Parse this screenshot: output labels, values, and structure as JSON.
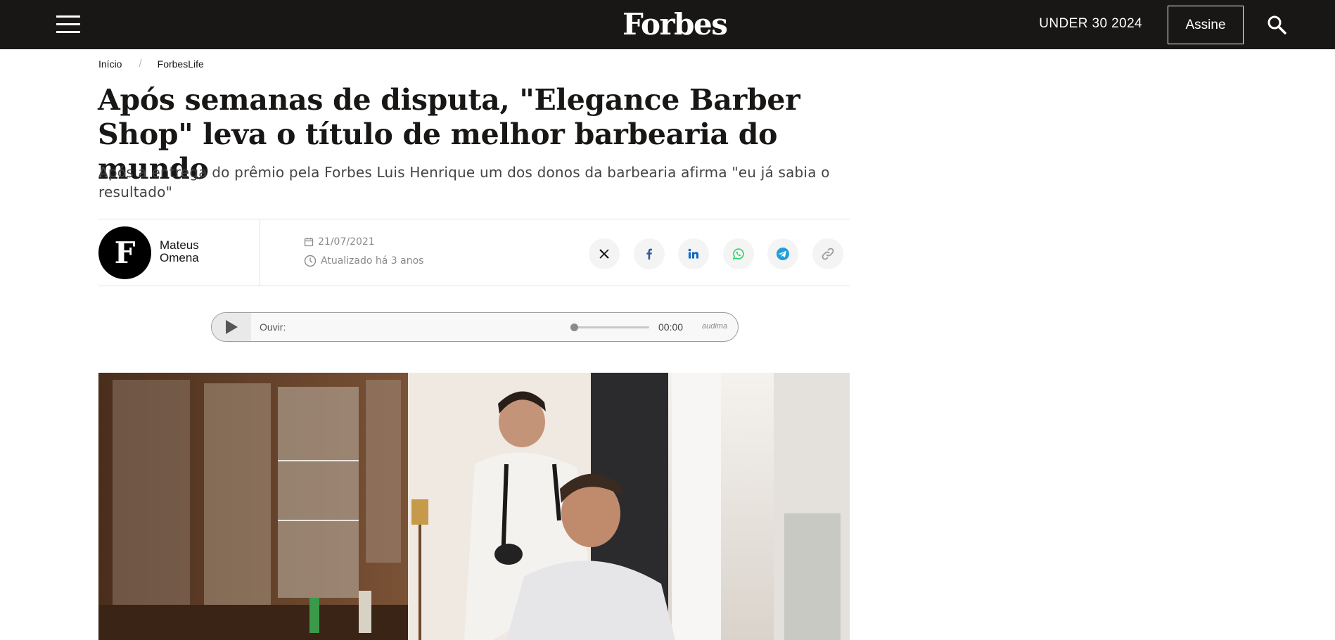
{
  "header": {
    "logo": "Forbes",
    "under30_label": "UNDER 30 2024",
    "subscribe_label": "Assine",
    "menu_icon": "hamburger-menu-icon",
    "search_icon": "search-icon",
    "background_color": "#181716"
  },
  "breadcrumb": {
    "items": [
      "Início",
      "ForbesLife"
    ],
    "separator": "/"
  },
  "article": {
    "title": "Após semanas de disputa, \"Elegance Barber Shop\" leva o título de melhor barbearia do mundo",
    "subtitle": "Após a entrega do prêmio pela Forbes Luis Henrique um dos donos da barbearia afirma \"eu já sabia o resultado\"",
    "author": {
      "initial": "F",
      "name": "Mateus Omena"
    },
    "published_date": "21/07/2021",
    "updated_text": "Atualizado há 3 anos"
  },
  "share": {
    "buttons": [
      {
        "name": "x",
        "icon": "x-twitter-icon",
        "color": "#181716"
      },
      {
        "name": "facebook",
        "icon": "facebook-icon",
        "color": "#3b5998"
      },
      {
        "name": "linkedin",
        "icon": "linkedin-icon",
        "color": "#0a66c2"
      },
      {
        "name": "whatsapp",
        "icon": "whatsapp-icon",
        "color": "#25d366"
      },
      {
        "name": "telegram",
        "icon": "telegram-icon",
        "color": "#229ed9"
      },
      {
        "name": "copy-link",
        "icon": "link-icon",
        "color": "#9a9a9a"
      }
    ]
  },
  "audio_player": {
    "label": "Ouvir:",
    "time": "00:00",
    "brand": "audima",
    "progress": 0
  },
  "hero_image": {
    "alt_icon": "barber-shop-photo"
  }
}
